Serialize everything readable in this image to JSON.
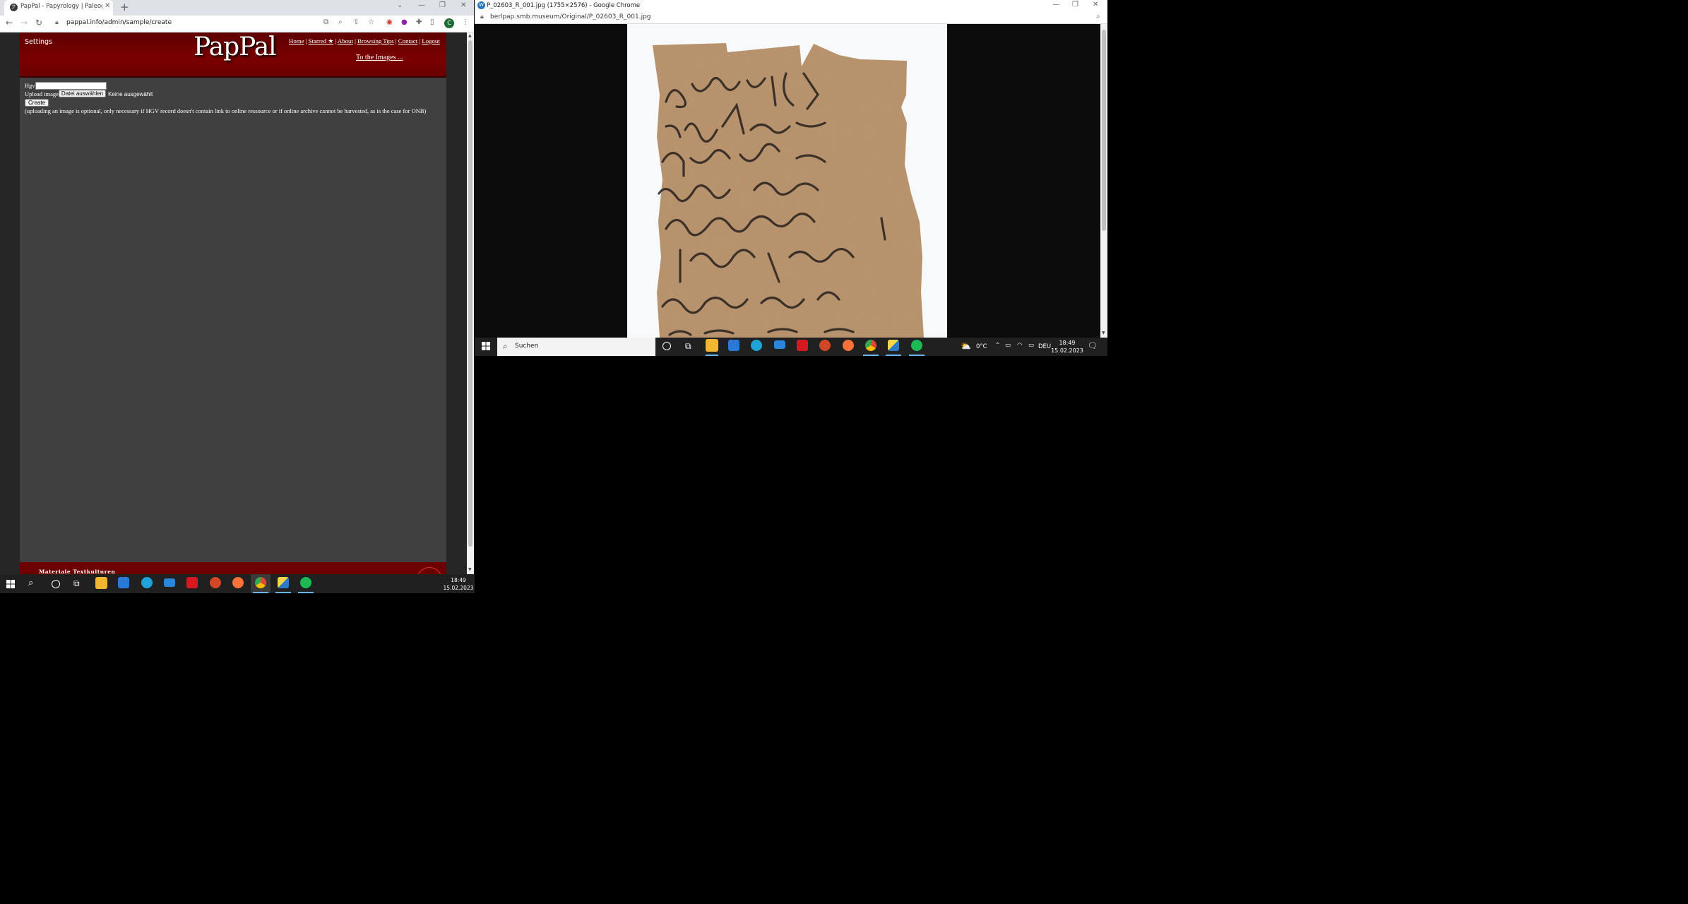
{
  "left_window": {
    "tab_title": "PapPal - Papyrology | Paleograph",
    "url": "pappal.info/admin/sample/create",
    "profile_initial": "C",
    "site": {
      "settings_label": "Settings",
      "logo": "PapPal",
      "nav": [
        "Home",
        "Starred ★",
        "About",
        "Browsing Tips",
        "Contact",
        "Logout"
      ],
      "to_images_link": "To the Images ...",
      "form": {
        "hgv_label": "Hgv",
        "upload_label": "Upload image",
        "choose_file_button": "Datei auswählen",
        "no_file_text": "Keine ausgewählt",
        "create_button": "Create",
        "note": "(uploading an image is optional, only necessary if HGV record doesn't contain link to online ressource or if online archive cannot be harvested, as is the case for ONB)"
      },
      "footer_text": "Materiale Textkulturen"
    }
  },
  "right_window": {
    "title": "P_02603_R_001.jpg (1755×2576) - Google Chrome",
    "url": "berlpap.smb.museum/Original/P_02603_R_001.jpg"
  },
  "taskbar_right": {
    "search_placeholder": "Suchen",
    "weather": "0°C",
    "language": "DEU",
    "time": "18:49",
    "date": "15.02.2023"
  },
  "taskbar_left": {
    "time": "18:49",
    "date": "15.02.2023"
  },
  "colors": {
    "header_red": "#7a0000",
    "page_gray": "#404040",
    "taskbar": "#202020"
  }
}
